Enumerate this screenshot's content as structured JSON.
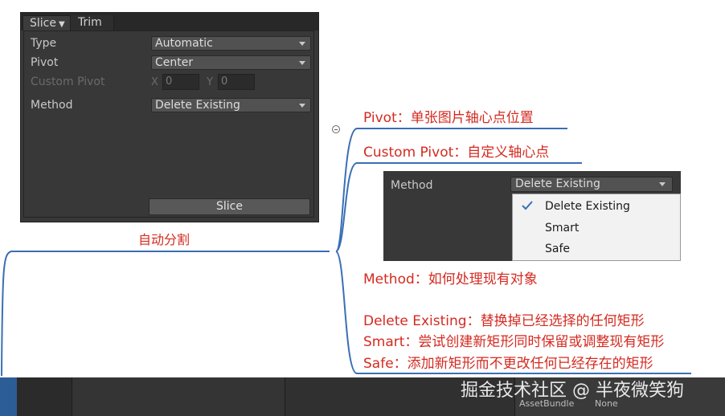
{
  "slice_panel": {
    "tabs": [
      "Slice",
      "Trim"
    ],
    "type_label": "Type",
    "type_value": "Automatic",
    "pivot_label": "Pivot",
    "pivot_value": "Center",
    "custom_pivot_label": "Custom Pivot",
    "x_label": "X",
    "x_value": "0",
    "y_label": "Y",
    "y_value": "0",
    "method_label": "Method",
    "method_value": "Delete Existing",
    "slice_button": "Slice"
  },
  "caption": "自动分割",
  "annotations": {
    "pivot": "Pivot：单张图片轴心点位置",
    "custom_pivot": "Custom Pivot：自定义轴心点",
    "method": "Method：如何处理现有对象",
    "delete_existing": "Delete Existing：替换掉已经选择的任何矩形",
    "smart": "Smart：尝试创建新矩形同时保留或调整现有矩形",
    "safe": "Safe：添加新矩形而不更改任何已经存在的矩形"
  },
  "method_inset": {
    "label": "Method",
    "selected": "Delete Existing",
    "options": [
      "Delete Existing",
      "Smart",
      "Safe"
    ]
  },
  "footer": {
    "watermark": "掘金技术社区 @ 半夜微笑狗",
    "asset_bundle": "AssetBundle",
    "none": "None"
  },
  "colors": {
    "annotation_red": "#d42a20",
    "line_blue": "#3a6fb5",
    "unity_dark": "#383838"
  }
}
